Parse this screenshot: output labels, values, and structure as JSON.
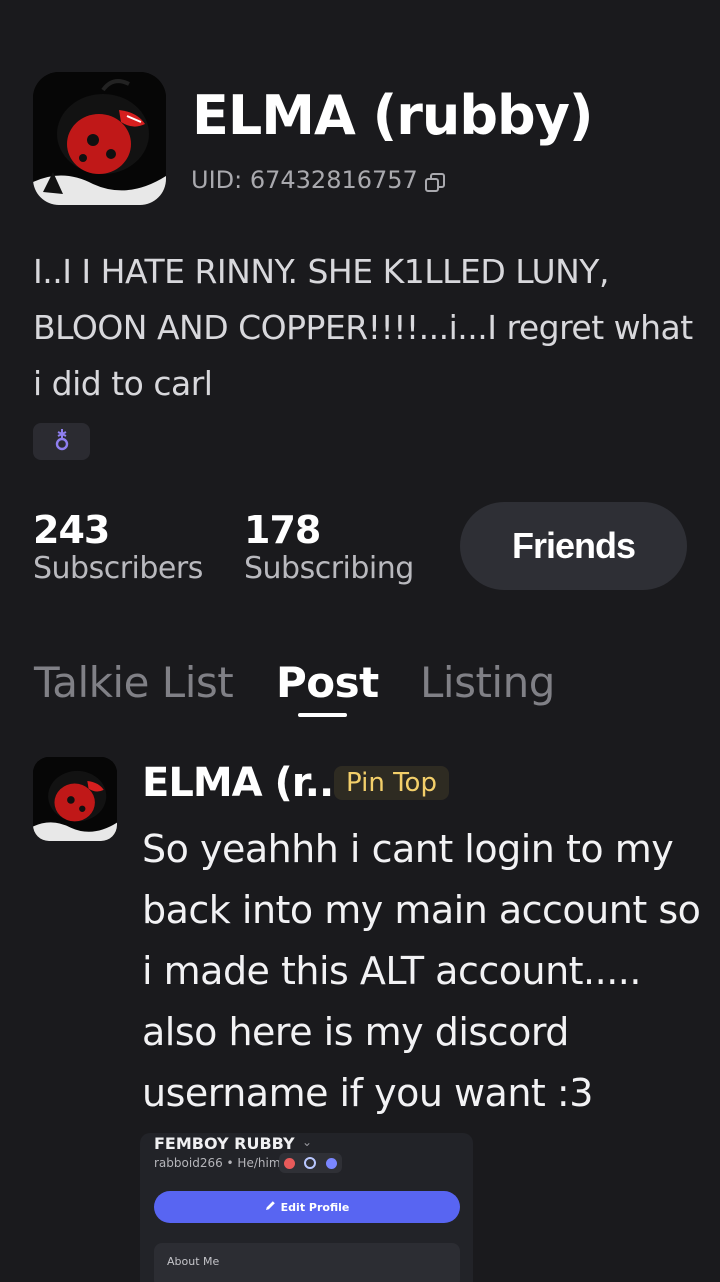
{
  "profile": {
    "name": "ELMA (rubby)",
    "uid": "UID: 67432816757",
    "bio": "I..I I HATE RINNY. SHE K1LLED LUNY, BLOON AND COPPER!!!!...i...I regret what i did to carl",
    "gender_icon": "gender-symbol-icon"
  },
  "stats": {
    "subscribers_count": "243",
    "subscribers_label": "Subscribers",
    "subscribing_count": "178",
    "subscribing_label": "Subscribing",
    "friends_label": "Friends"
  },
  "tabs": [
    {
      "label": "Talkie List",
      "active": false
    },
    {
      "label": "Post",
      "active": true
    },
    {
      "label": "Listing",
      "active": false
    }
  ],
  "post": {
    "author": "ELMA (r...",
    "pin_label": "Pin Top",
    "text": "So yeahhh i cant login to my back into my main account so i made this ALT account..... also here is my discord username if you want :3",
    "image": {
      "display_name": "FEMBOY RUBBY",
      "subline": "rabboid266 • He/him",
      "edit_profile_label": "Edit Profile",
      "about_me_label": "About Me"
    }
  },
  "colors": {
    "background": "#1a1a1d",
    "pin_text": "#f3cf6a",
    "discord_blurple": "#5865f2",
    "gender_icon": "#8f7ff0"
  }
}
